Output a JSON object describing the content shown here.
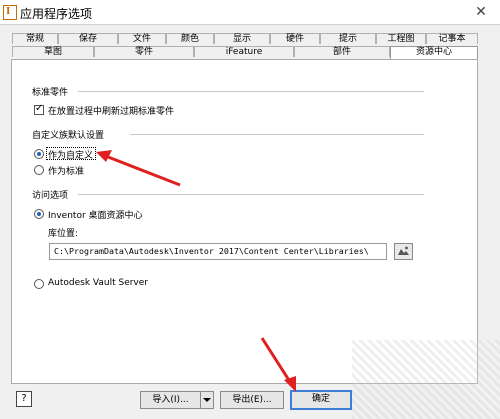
{
  "window": {
    "title": "应用程序选项",
    "close_glyph": "✕"
  },
  "tabs_top": [
    "常规",
    "保存",
    "文件",
    "颜色",
    "显示",
    "硬件",
    "提示",
    "工程图",
    "记事本"
  ],
  "tabs_bottom": [
    "草图",
    "零件",
    "iFeature",
    "部件",
    "资源中心"
  ],
  "active_tab": "资源中心",
  "sections": {
    "standard_parts": {
      "title": "标准零件",
      "refresh_checkbox_label": "在放置过程中刷新过期标准零件",
      "refresh_checked": true
    },
    "custom_family": {
      "title": "自定义族默认设置",
      "options": [
        "作为自定义",
        "作为标准"
      ],
      "selected": "作为自定义"
    },
    "access": {
      "title": "访问选项",
      "desktop_option": "Inventor 桌面资源中心",
      "library_location_label": "库位置:",
      "library_path": "C:\\ProgramData\\Autodesk\\Inventor 2017\\Content Center\\Libraries\\",
      "vault_option": "Autodesk Vault Server",
      "selected": "Inventor 桌面资源中心"
    }
  },
  "buttons": {
    "help": "?",
    "import": "导入(I)...",
    "export": "导出(E)...",
    "ok": "确定"
  },
  "icons": {
    "browse": "folder-browse-icon",
    "dropdown": "dropdown-arrow-icon"
  },
  "colors": {
    "annotation_arrow": "#e02020",
    "radio_dot": "#1e5fbf"
  }
}
